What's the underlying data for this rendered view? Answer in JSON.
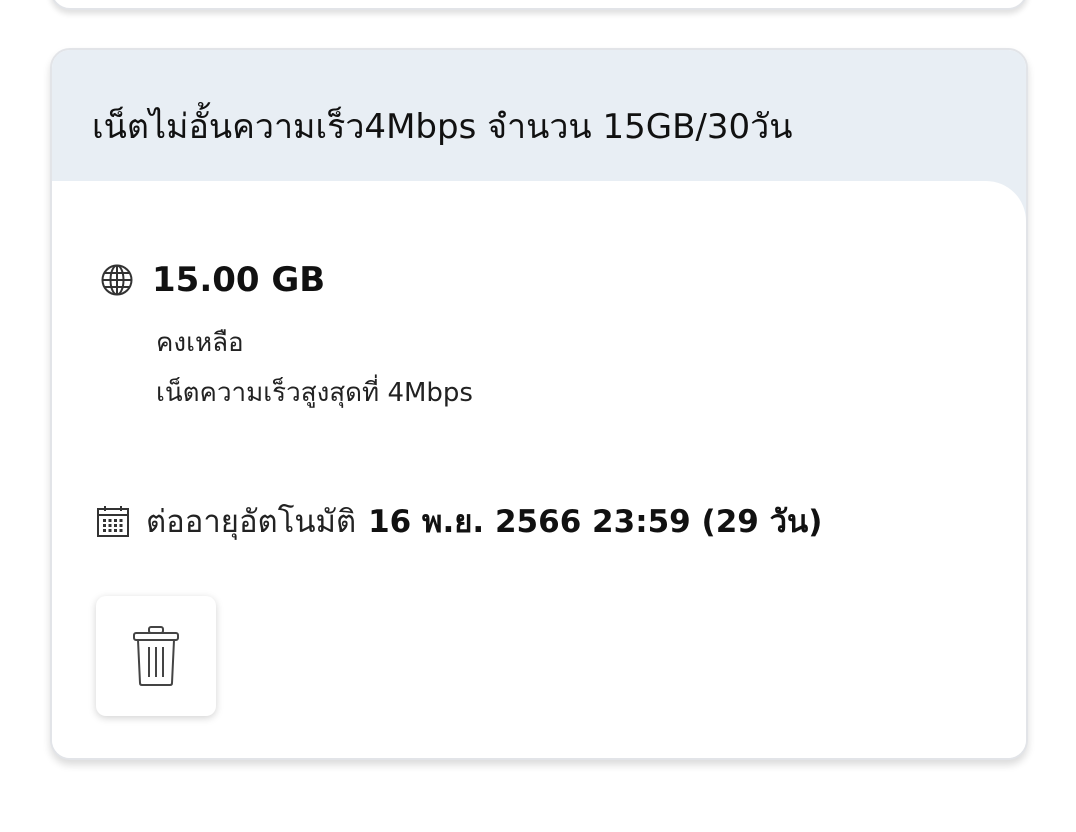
{
  "package": {
    "title": "เน็ตไม่อั้นความเร็ว4Mbps จำนวน 15GB/30วัน",
    "data_amount": "15.00 GB",
    "remaining_label": "คงเหลือ",
    "speed_label": "เน็ตความเร็วสูงสุดที่ 4Mbps",
    "renew_label": "ต่ออายุอัตโนมัติ",
    "renew_date": "16 พ.ย. 2566 23:59 (29 วัน)"
  },
  "icons": {
    "data": "globe-icon",
    "renew": "calendar-icon",
    "delete": "trash-icon"
  },
  "colors": {
    "header_bg": "#e8eef4",
    "card_border": "#e2e4e8",
    "text": "#111111"
  }
}
